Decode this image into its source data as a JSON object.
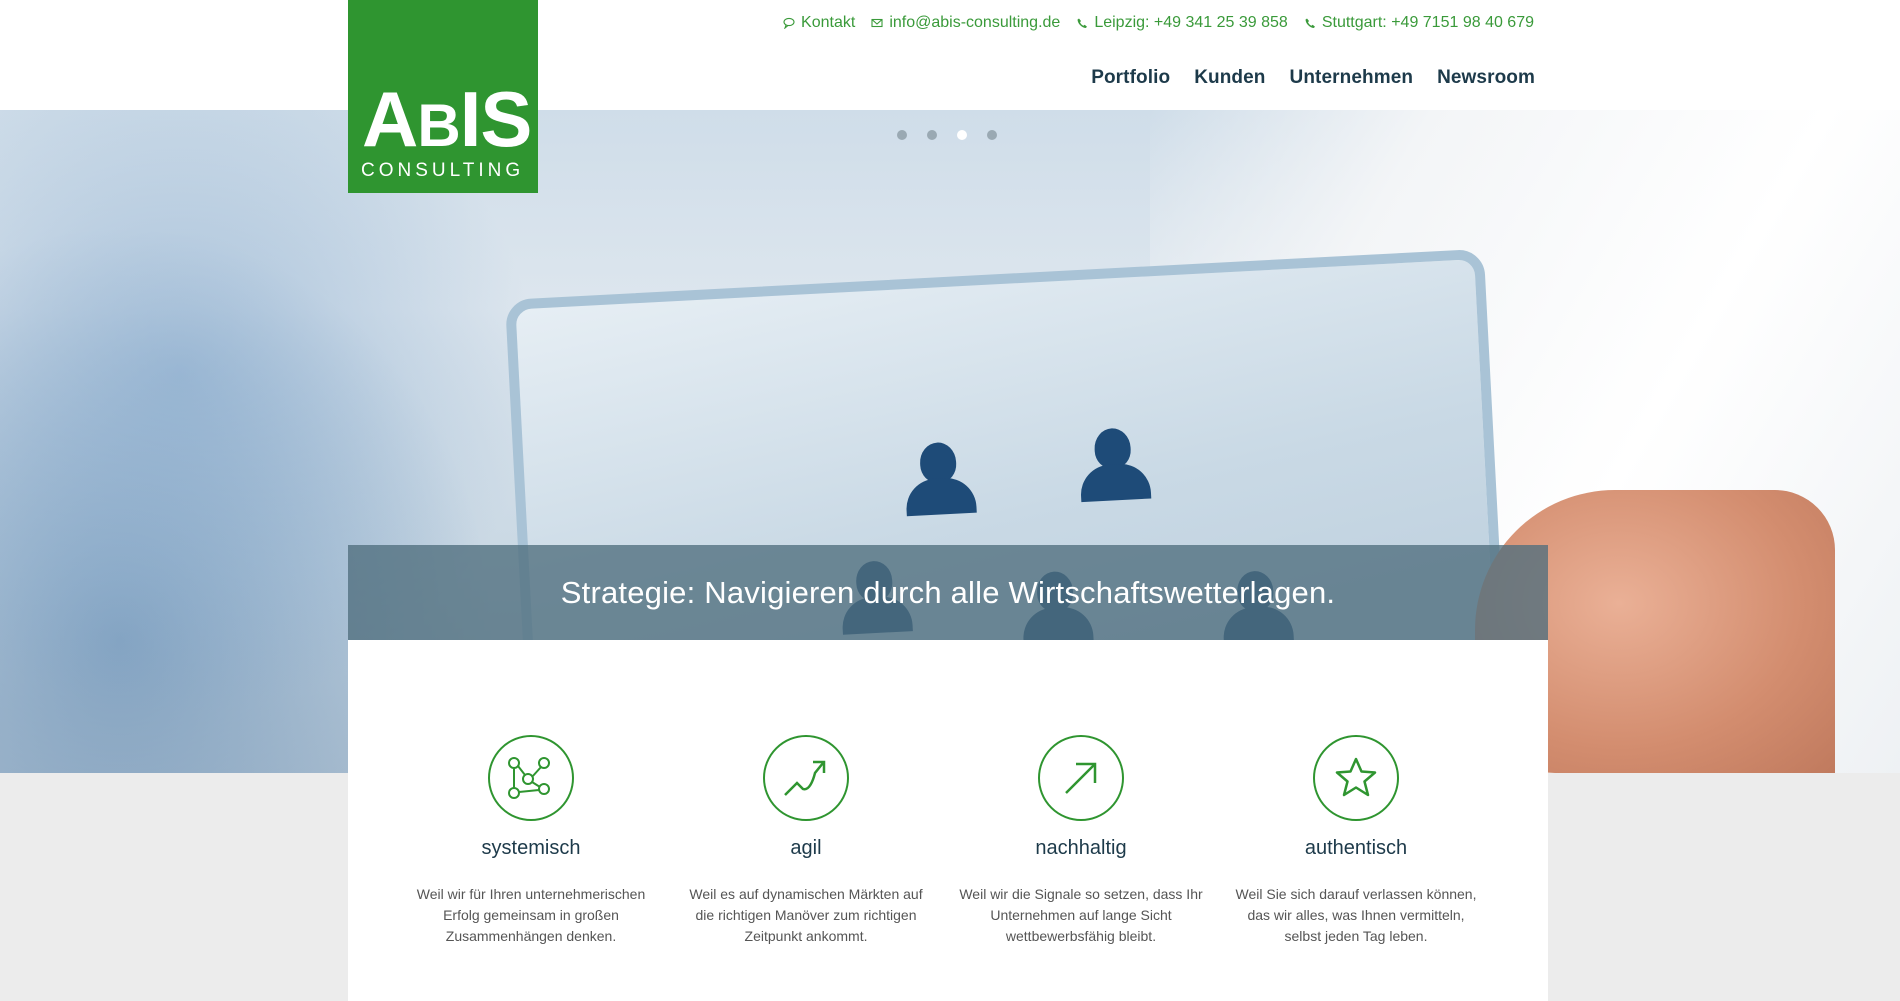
{
  "logo": {
    "main_big": "A",
    "main_small": "B",
    "main_rest": "IS",
    "sub": "CONSULTING"
  },
  "topbar": {
    "contact": "Kontakt",
    "email": "info@abis-consulting.de",
    "phone_leipzig": "Leipzig: +49 341 25 39 858",
    "phone_stuttgart": "Stuttgart: +49 7151 98 40 679"
  },
  "nav": [
    "Portfolio",
    "Kunden",
    "Unternehmen",
    "Newsroom"
  ],
  "slider": {
    "active_index": 2,
    "dot_count": 4,
    "caption": "Strategie: Navigieren durch alle Wirtschaftswetterlagen."
  },
  "features": [
    {
      "icon": "network-icon",
      "title": "systemisch",
      "text": "Weil wir für Ihren unternehmerischen Erfolg gemeinsam in großen Zusammenhängen denken."
    },
    {
      "icon": "trend-arrow-icon",
      "title": "agil",
      "text": "Weil es auf dynamischen Märkten auf die richtigen Manöver zum richtigen Zeitpunkt ankommt."
    },
    {
      "icon": "arrow-up-right-icon",
      "title": "nachhaltig",
      "text": "Weil wir die Signale so setzen, dass Ihr Unternehmen auf lange Sicht wettbewerbsfähig bleibt."
    },
    {
      "icon": "star-icon",
      "title": "authentisch",
      "text": "Weil Sie sich darauf verlassen können, das wir alles, was Ihnen vermitteln, selbst jeden Tag leben."
    }
  ],
  "colors": {
    "brand_green": "#2f9530",
    "nav_text": "#1d3a4a",
    "topbar_text": "#3a9a3a",
    "caption_bg": "#506e7d"
  }
}
